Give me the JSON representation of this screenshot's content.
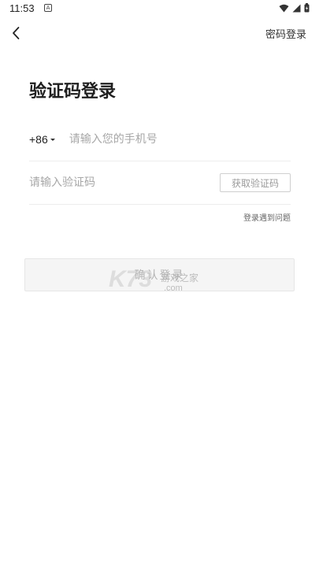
{
  "status_bar": {
    "time": "11:53",
    "notification_icon": "A",
    "icons": [
      "wifi-icon",
      "signal-icon",
      "battery-icon"
    ]
  },
  "header": {
    "back_icon": "chevron-left-icon",
    "password_login_label": "密码登录"
  },
  "main": {
    "title": "验证码登录",
    "phone": {
      "country_code": "+86",
      "placeholder": "请输入您的手机号",
      "value": ""
    },
    "code": {
      "placeholder": "请输入验证码",
      "value": "",
      "get_code_label": "获取验证码"
    },
    "trouble_label": "登录遇到问题",
    "confirm_label": "确认登录"
  },
  "watermark": {
    "brand": "K73",
    "text": "游戏之家",
    "domain": ".com"
  },
  "colors": {
    "text_primary": "#222222",
    "placeholder": "#a7a7a7",
    "divider": "#ededed",
    "button_disabled_bg": "#f5f5f5",
    "button_disabled_text": "#b3b3b3"
  }
}
